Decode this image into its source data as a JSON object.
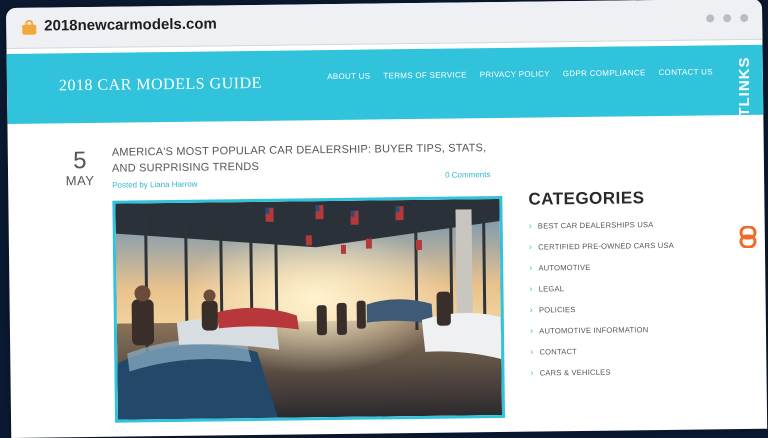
{
  "browser": {
    "url": "2018newcarmodels.com"
  },
  "site": {
    "logo": "2018 CAR MODELS GUIDE",
    "nav": [
      "ABOUT US",
      "TERMS OF SERVICE",
      "PRIVACY POLICY",
      "GDPR COMPLIANCE",
      "CONTACT US"
    ]
  },
  "post": {
    "day": "5",
    "month": "MAY",
    "title": "AMERICA'S MOST POPULAR CAR DEALERSHIP: BUYER TIPS, STATS, AND SURPRISING TRENDS",
    "posted_by_prefix": "Posted by",
    "author": "Liana Harrow",
    "comments": "0 Comments"
  },
  "sidebar": {
    "title": "CATEGORIES",
    "items": [
      "BEST CAR DEALERSHIPS USA",
      "CERTIFIED PRE-OWNED CARS USA",
      "AUTOMOTIVE",
      "LEGAL",
      "POLICIES",
      "AUTOMOTIVE INFORMATION",
      "CONTACT",
      "CARS & VEHICLES"
    ]
  },
  "watermark": {
    "text": "GUESTPOSTLINKS"
  },
  "colors": {
    "accent": "#31c3dc",
    "lock": "#f2a93b"
  }
}
